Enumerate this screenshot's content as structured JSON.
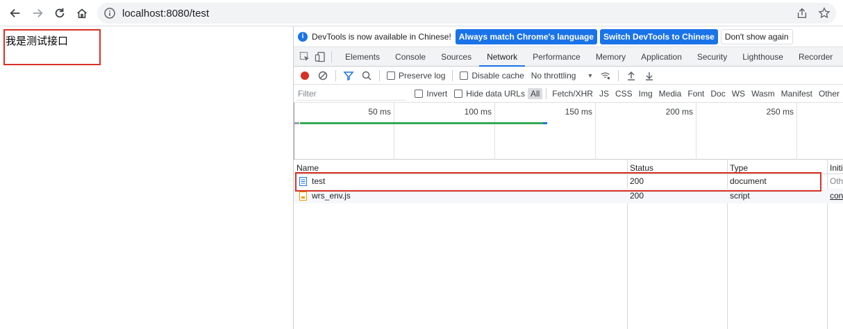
{
  "browser": {
    "url": "localhost:8080/test"
  },
  "page": {
    "text": "我是测试接口"
  },
  "devtools": {
    "infobar": {
      "message": "DevTools is now available in Chinese!",
      "btn_match": "Always match Chrome's language",
      "btn_switch": "Switch DevTools to Chinese",
      "btn_dismiss": "Don't show again"
    },
    "tabs": [
      "Elements",
      "Console",
      "Sources",
      "Network",
      "Performance",
      "Memory",
      "Application",
      "Security",
      "Lighthouse",
      "Recorder"
    ],
    "active_tab": "Network",
    "controls": {
      "preserve_log": "Preserve log",
      "disable_cache": "Disable cache",
      "throttling": "No throttling"
    },
    "filter": {
      "placeholder": "Filter",
      "invert": "Invert",
      "hide_data_urls": "Hide data URLs",
      "types": [
        "All",
        "Fetch/XHR",
        "JS",
        "CSS",
        "Img",
        "Media",
        "Font",
        "Doc",
        "WS",
        "Wasm",
        "Manifest",
        "Other"
      ],
      "selected_type": "All"
    },
    "timeline": {
      "ticks": [
        "50 ms",
        "100 ms",
        "150 ms",
        "200 ms",
        "250 ms"
      ]
    },
    "table": {
      "columns": [
        "Name",
        "Status",
        "Type",
        "Initiator"
      ],
      "rows": [
        {
          "name": "test",
          "status": "200",
          "type": "document",
          "initiator": "Other"
        },
        {
          "name": "wrs_env.js",
          "status": "200",
          "type": "script",
          "initiator": "content"
        }
      ]
    },
    "colors": {
      "accent": "#1a73e8",
      "highlight": "#d93025",
      "record": "#d93025",
      "load_bar": "#34a853"
    }
  }
}
